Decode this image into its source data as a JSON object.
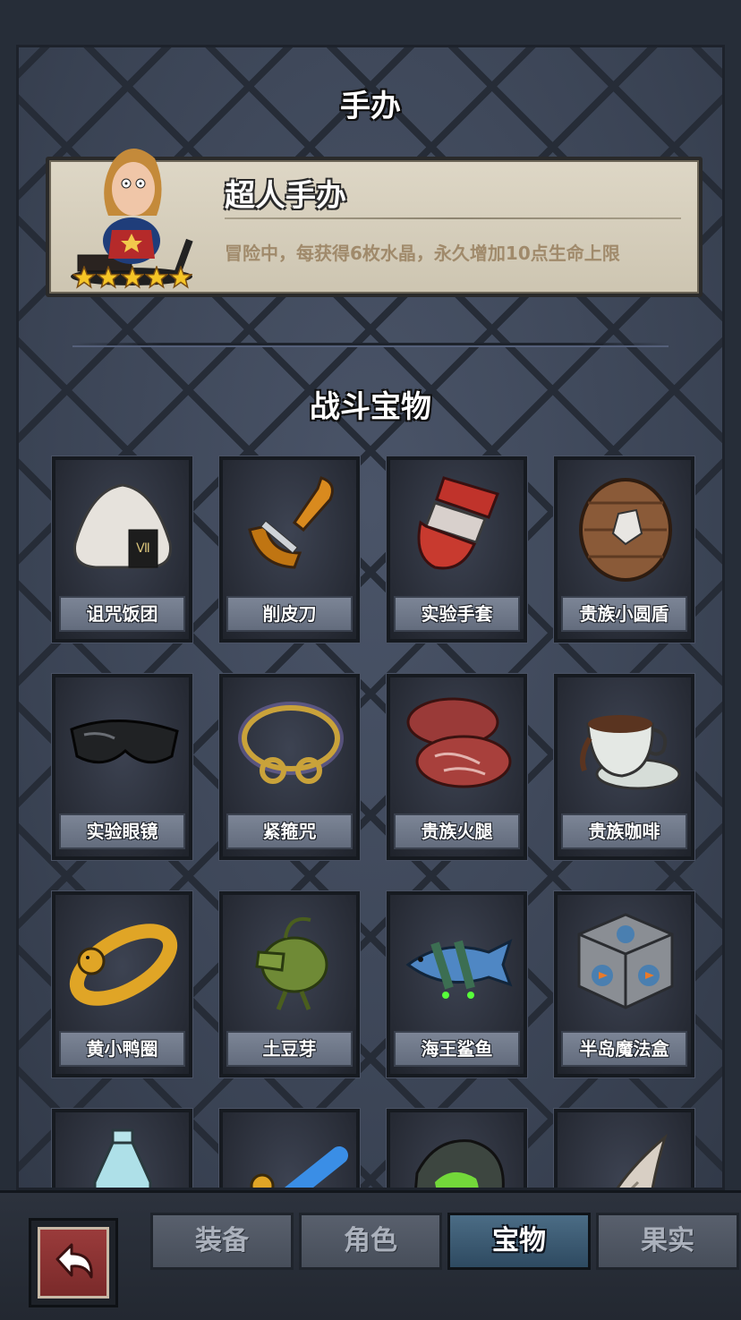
{
  "figure_section": {
    "title": "手办",
    "figure": {
      "name": "超人手办",
      "description": "冒险中，每获得6枚水晶，永久增加10点生命上限",
      "stars": 5
    }
  },
  "treasure_section": {
    "title": "战斗宝物",
    "items": [
      {
        "name": "诅咒饭团",
        "icon": "rice-ball-icon"
      },
      {
        "name": "削皮刀",
        "icon": "peeler-icon"
      },
      {
        "name": "实验手套",
        "icon": "glove-icon"
      },
      {
        "name": "贵族小圆盾",
        "icon": "round-shield-icon"
      },
      {
        "name": "实验眼镜",
        "icon": "goggles-icon"
      },
      {
        "name": "紧箍咒",
        "icon": "golden-headband-icon"
      },
      {
        "name": "贵族火腿",
        "icon": "ham-icon"
      },
      {
        "name": "贵族咖啡",
        "icon": "coffee-cup-icon"
      },
      {
        "name": "黄小鸭圈",
        "icon": "duck-ring-icon"
      },
      {
        "name": "土豆芽",
        "icon": "potato-sprout-icon"
      },
      {
        "name": "海王鲨鱼",
        "icon": "shark-icon"
      },
      {
        "name": "半岛魔法盒",
        "icon": "magic-cube-icon"
      },
      {
        "name": "",
        "icon": "potion-bottle-icon"
      },
      {
        "name": "",
        "icon": "blue-ring-icon"
      },
      {
        "name": "",
        "icon": "green-rock-icon"
      },
      {
        "name": "",
        "icon": "horn-icon"
      }
    ]
  },
  "bottom_nav": {
    "back_icon": "back-arrow-icon",
    "tabs": [
      {
        "label": "装备",
        "active": false
      },
      {
        "label": "角色",
        "active": false
      },
      {
        "label": "宝物",
        "active": true
      },
      {
        "label": "果实",
        "active": false
      }
    ]
  },
  "colors": {
    "active_tab": "#3b5b74",
    "star": "#f5c526",
    "card_bg": "#d6cfbd"
  }
}
